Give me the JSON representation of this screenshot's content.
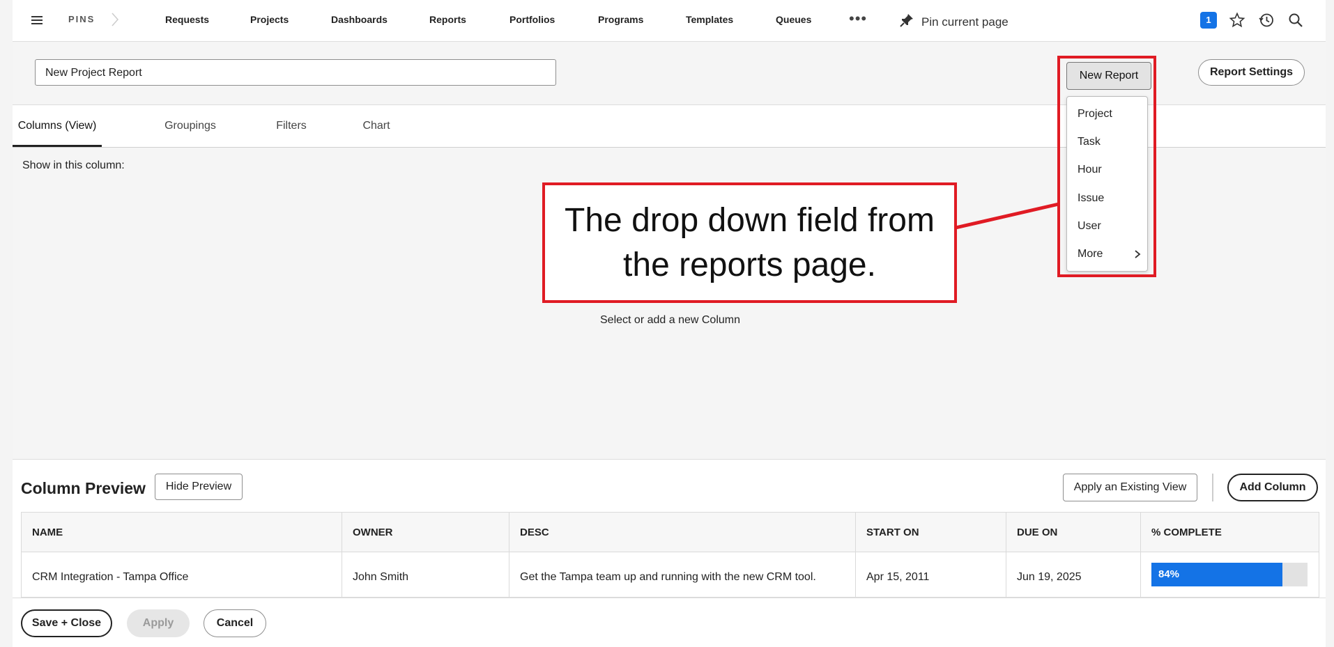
{
  "nav": {
    "brand": "PINS",
    "links": [
      "Requests",
      "Projects",
      "Dashboards",
      "Reports",
      "Portfolios",
      "Programs",
      "Templates",
      "Queues"
    ],
    "more": "•••",
    "pin_label": "Pin current page",
    "badge_count": "1",
    "icons": [
      "menu-icon",
      "chevron-right-icon",
      "pin-icon",
      "star-icon",
      "history-icon",
      "search-icon"
    ]
  },
  "report": {
    "name_value": "New Project Report",
    "new_report_label": "New Report",
    "settings_label": "Report Settings"
  },
  "tabs": [
    "Columns (View)",
    "Groupings",
    "Filters",
    "Chart"
  ],
  "columns_view": {
    "show_label": "Show in this column:",
    "empty_message": "Select or add a new Column"
  },
  "dropdown": {
    "items": [
      "Project",
      "Task",
      "Hour",
      "Issue",
      "User",
      "More"
    ]
  },
  "annotation": {
    "text": "The drop down field from the reports page.",
    "color": "#e01b24"
  },
  "preview": {
    "title": "Column Preview",
    "hide_label": "Hide Preview",
    "apply_view_label": "Apply an Existing View",
    "add_column_label": "Add Column",
    "headers": [
      "NAME",
      "OWNER",
      "DESC",
      "START ON",
      "DUE ON",
      "% COMPLETE"
    ],
    "row": {
      "name": "CRM Integration - Tampa Office",
      "owner": "John Smith",
      "desc": "Get the Tampa team up and running with the new CRM tool.",
      "start_on": "Apr 15, 2011",
      "due_on": "Jun 19, 2025",
      "percent_label": "84%",
      "percent": 84
    },
    "accent_color": "#1473e6"
  },
  "footer": {
    "save_close_label": "Save + Close",
    "apply_label": "Apply",
    "cancel_label": "Cancel"
  }
}
